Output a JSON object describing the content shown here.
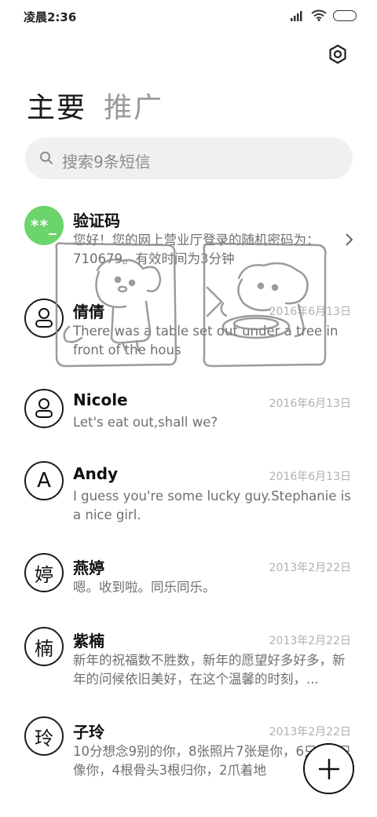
{
  "status_bar": {
    "time": "凌晨2:36"
  },
  "header": {
    "tabs": [
      {
        "label": "主要",
        "active": true
      },
      {
        "label": "推广",
        "active": false
      }
    ]
  },
  "search": {
    "placeholder": "搜索9条短信"
  },
  "conversations": [
    {
      "name": "验证码",
      "avatar": "**_",
      "avatar_color": "#6bd46a",
      "date": "",
      "preview": "您好！您的网上营业厅登录的随机密码为：710679。有效时间为3分钟"
    },
    {
      "name": "倩倩",
      "avatar": "person-icon",
      "date": "2016年6月13日",
      "preview": "There was a table set out under a tree in front of the hous"
    },
    {
      "name": "Nicole",
      "avatar": "person-icon",
      "date": "2016年6月13日",
      "preview": "Let's eat out,shall we?"
    },
    {
      "name": "Andy",
      "avatar": "A",
      "date": "2016年6月13日",
      "preview": "I guess you're some lucky guy.Stephanie is a nice girl."
    },
    {
      "name": "燕婷",
      "avatar": "婷",
      "date": "2013年2月22日",
      "preview": "嗯。收到啦。同乐同乐。"
    },
    {
      "name": "紫楠",
      "avatar": "楠",
      "date": "2013年2月22日",
      "preview": "新年的祝福数不胜数，新年的愿望好多好多，新年的问候依旧美好，在这个温馨的时刻，..."
    },
    {
      "name": "子玲",
      "avatar": "玲",
      "date": "2013年2月22日",
      "preview": "10分想念9别的你，8张照片7张是你，6只狗5只像你，4根骨头3根归你，2爪着地"
    }
  ],
  "fab": {
    "icon": "plus-icon"
  }
}
